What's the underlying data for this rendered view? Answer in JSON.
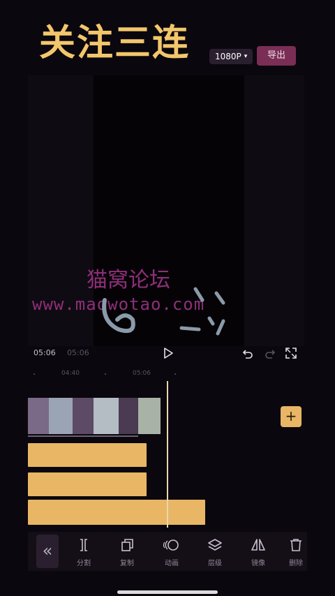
{
  "overlay": {
    "title": "关注三连"
  },
  "topbar": {
    "resolution": "1080P",
    "export_label": "导出"
  },
  "watermark": {
    "site_name": "猫窝论坛",
    "url": "www.maowotao.com"
  },
  "playback": {
    "current_time": "05:06",
    "total_time": "05:06"
  },
  "ruler": {
    "ticks": [
      "04:40",
      "05:06"
    ]
  },
  "toolbar": {
    "items": [
      {
        "label": "分割",
        "icon": "split-icon"
      },
      {
        "label": "复制",
        "icon": "copy-icon"
      },
      {
        "label": "动画",
        "icon": "animation-icon"
      },
      {
        "label": "层级",
        "icon": "layers-icon"
      },
      {
        "label": "镜像",
        "icon": "mirror-icon"
      },
      {
        "label": "删除",
        "icon": "delete-icon"
      }
    ]
  },
  "colors": {
    "accent": "#e8b664",
    "export_bg": "#7a2e55",
    "watermark": "#8e2f79",
    "title": "#f2c66b"
  }
}
